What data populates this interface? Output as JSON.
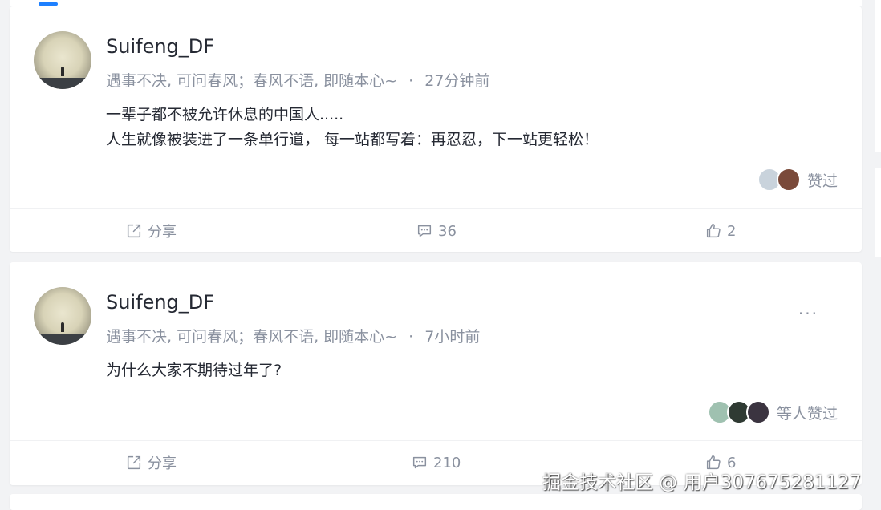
{
  "posts": [
    {
      "username": "Suifeng_DF",
      "bio": "遇事不决, 可问春风；春风不语, 即随本心~",
      "separator": "·",
      "time": "27分钟前",
      "content": [
        "一辈子都不被允许休息的中国人.....",
        "人生就像被装进了一条单行道， 每一站都写着：再忍忍，下一站更轻松！"
      ],
      "likers_label": "赞过",
      "actions": {
        "share": "分享",
        "comments": "36",
        "likes": "2"
      }
    },
    {
      "username": "Suifeng_DF",
      "bio": "遇事不决, 可问春风；春风不语, 即随本心~",
      "separator": "·",
      "time": "7小时前",
      "content": [
        "为什么大家不期待过年了?"
      ],
      "likers_label": "等人赞过",
      "more": "···",
      "actions": {
        "share": "分享",
        "comments": "210",
        "likes": "6"
      }
    }
  ],
  "watermark": "掘金技术社区 @ 用户307675281127",
  "colors": {
    "accent": "#1e80ff",
    "text": "#252933",
    "muted": "#8a919f",
    "background": "#f2f3f5"
  }
}
